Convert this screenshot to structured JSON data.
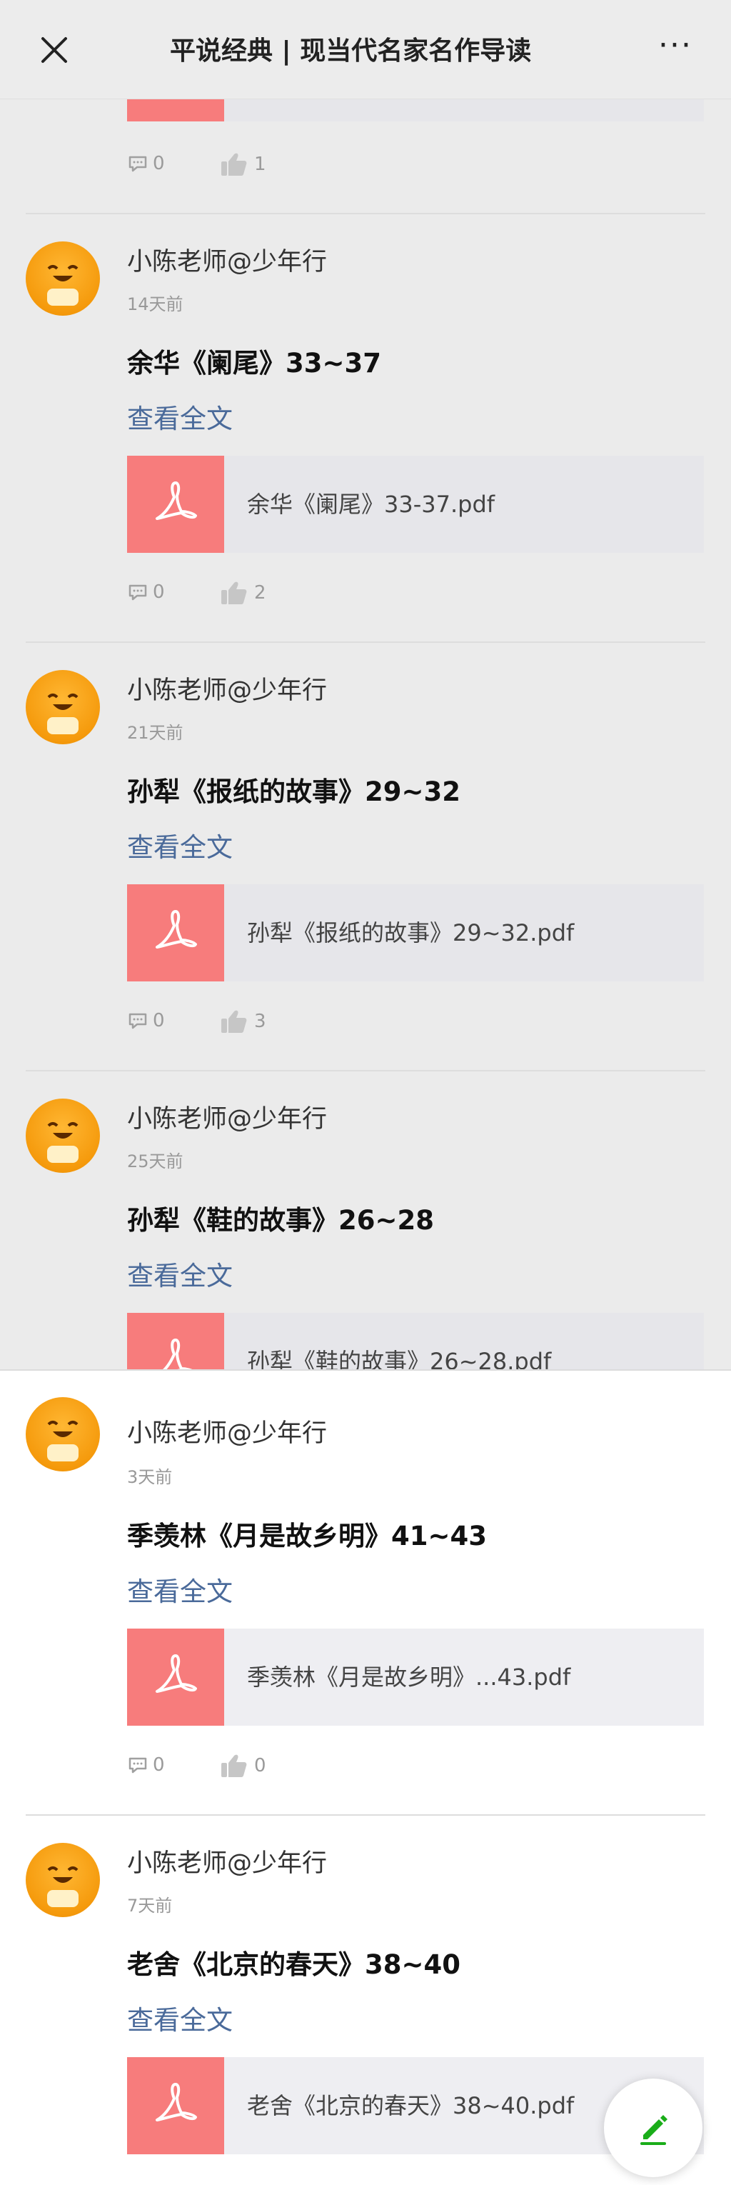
{
  "header": {
    "title": "平说经典 | 现当代名家名作导读",
    "more": "···"
  },
  "top_partial": {
    "comments": "0",
    "likes": "1"
  },
  "posts": [
    {
      "author": "小陈老师@少年行",
      "time": "14天前",
      "title": "余华《阑尾》33~37",
      "read_more": "查看全文",
      "file": "余华《阑尾》33-37.pdf",
      "comments": "0",
      "likes": "2"
    },
    {
      "author": "小陈老师@少年行",
      "time": "21天前",
      "title": "孙犁《报纸的故事》29~32",
      "read_more": "查看全文",
      "file": "孙犁《报纸的故事》29~32.pdf",
      "comments": "0",
      "likes": "3"
    },
    {
      "author": "小陈老师@少年行",
      "time": "25天前",
      "title": "孙犁《鞋的故事》26~28",
      "read_more": "查看全文",
      "file": "孙犁《鞋的故事》26~28.pdf",
      "comments": "",
      "likes": ""
    },
    {
      "author": "小陈老师@少年行",
      "time": "3天前",
      "title": "季羡林《月是故乡明》41~43",
      "read_more": "查看全文",
      "file": "季羡林《月是故乡明》...43.pdf",
      "comments": "0",
      "likes": "0"
    },
    {
      "author": "小陈老师@少年行",
      "time": "7天前",
      "title": "老舍《北京的春天》38~40",
      "read_more": "查看全文",
      "file": "老舍《北京的春天》38~40.pdf",
      "comments": "",
      "likes": ""
    }
  ]
}
